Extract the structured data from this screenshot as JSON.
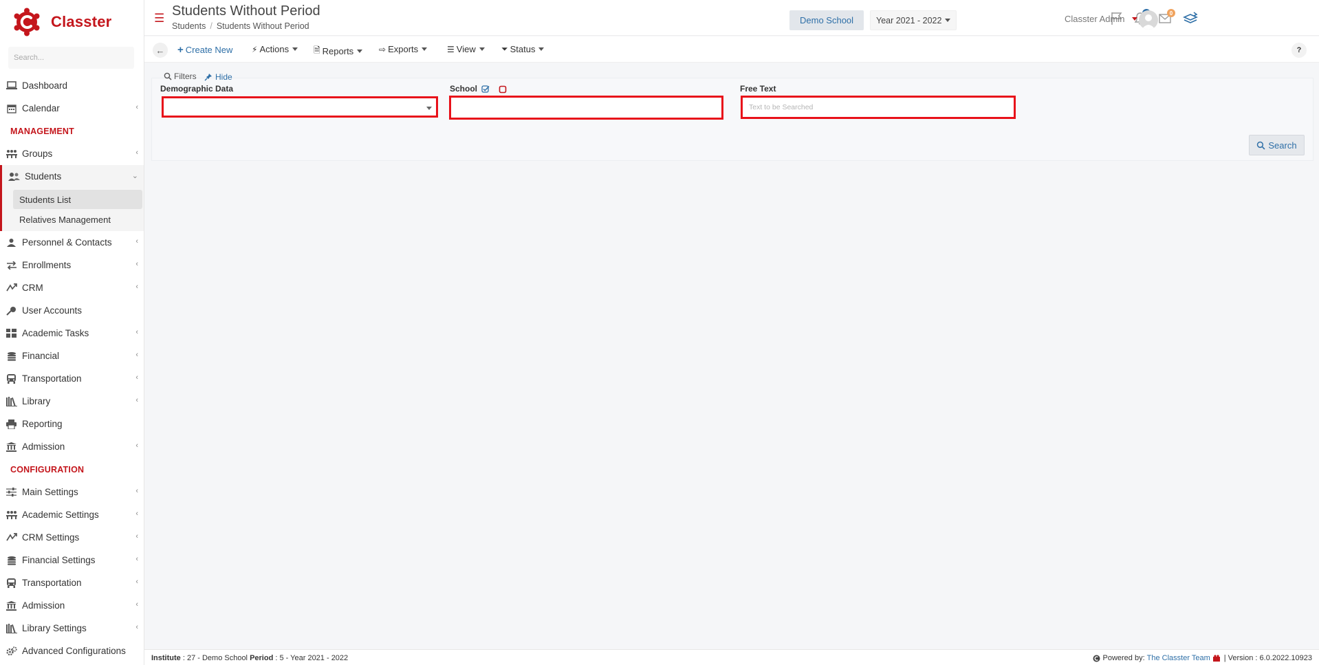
{
  "app": {
    "brand": "Classter",
    "brand_color": "#c4161c",
    "accent_color": "#2e6fa7",
    "alert_color": "#e8111a"
  },
  "sidebar": {
    "search_placeholder": "Search...",
    "items": [
      {
        "label": "Dashboard",
        "icon": "laptop-icon"
      },
      {
        "label": "Calendar",
        "icon": "calendar-icon"
      }
    ],
    "management_header": "MANAGEMENT",
    "management_items": [
      {
        "label": "Groups",
        "icon": "groups-icon"
      },
      {
        "label": "Students",
        "icon": "students-icon"
      },
      {
        "label": "Personnel & Contacts",
        "icon": "personnel-icon"
      },
      {
        "label": "Enrollments",
        "icon": "enrollments-icon"
      },
      {
        "label": "CRM",
        "icon": "crm-icon"
      },
      {
        "label": "User Accounts",
        "icon": "key-icon"
      },
      {
        "label": "Academic Tasks",
        "icon": "tasks-icon"
      },
      {
        "label": "Financial",
        "icon": "coins-icon"
      },
      {
        "label": "Transportation",
        "icon": "bus-icon"
      },
      {
        "label": "Library",
        "icon": "library-icon"
      },
      {
        "label": "Reporting",
        "icon": "printer-icon"
      },
      {
        "label": "Admission",
        "icon": "institution-icon"
      }
    ],
    "students_subitems": [
      {
        "label": "Students List"
      },
      {
        "label": "Relatives Management"
      }
    ],
    "configuration_header": "CONFIGURATION",
    "configuration_items": [
      {
        "label": "Main Settings",
        "icon": "sliders-icon"
      },
      {
        "label": "Academic Settings",
        "icon": "groups-icon"
      },
      {
        "label": "CRM Settings",
        "icon": "crm-icon"
      },
      {
        "label": "Financial Settings",
        "icon": "coins-icon"
      },
      {
        "label": "Transportation",
        "icon": "bus-icon"
      },
      {
        "label": "Admission",
        "icon": "institution-icon"
      },
      {
        "label": "Library Settings",
        "icon": "library-icon"
      },
      {
        "label": "Advanced Configurations",
        "icon": "gears-icon"
      }
    ]
  },
  "header": {
    "title": "Students Without Period",
    "breadcrumb": [
      "Students",
      "Students Without Period"
    ],
    "school": "Demo School",
    "year": "Year 2021 - 2022",
    "notifications_count": "0",
    "messages_count": "0",
    "user": "Classter Admin"
  },
  "toolbar": {
    "create_new": "Create New",
    "actions": "Actions",
    "reports": "Reports",
    "exports": "Exports",
    "view": "View",
    "status": "Status",
    "help": "?"
  },
  "filters": {
    "title": "Filters",
    "hide": "Hide",
    "demographic_label": "Demographic Data",
    "demographic_value": "",
    "school_label": "School",
    "school_value": "",
    "free_text_label": "Free Text",
    "free_text_placeholder": "Text to be Searched",
    "free_text_value": "",
    "search_button": "Search"
  },
  "footer": {
    "institute_label": "Institute",
    "institute_value": ": 27 - Demo School",
    "period_label": "Period",
    "period_value": ": 5 - Year 2021 - 2022",
    "powered_by": "Powered by:",
    "team": "The Classter Team",
    "version": "| Version : 6.0.2022.10923"
  }
}
